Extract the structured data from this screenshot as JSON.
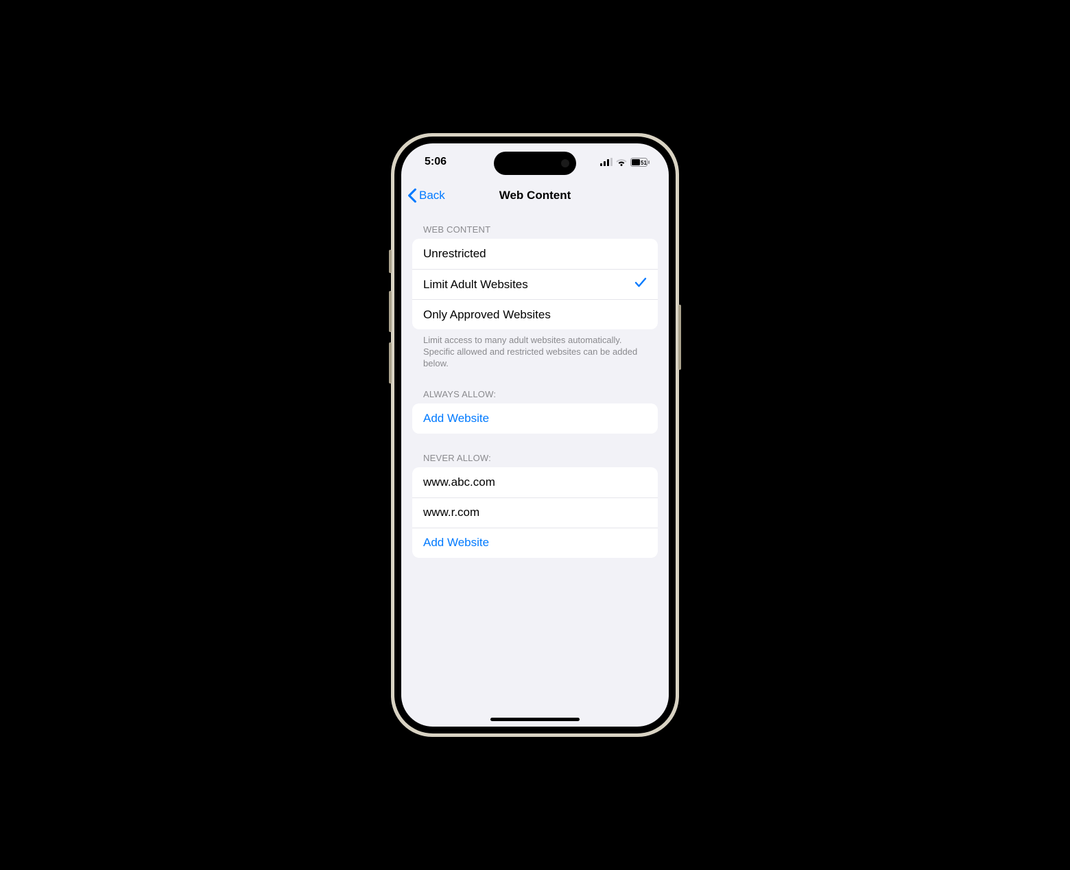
{
  "status_bar": {
    "time": "5:06",
    "battery_text": "51"
  },
  "nav": {
    "back_label": "Back",
    "title": "Web Content"
  },
  "web_content": {
    "header": "WEB CONTENT",
    "options": [
      {
        "label": "Unrestricted",
        "selected": false
      },
      {
        "label": "Limit Adult Websites",
        "selected": true
      },
      {
        "label": "Only Approved Websites",
        "selected": false
      }
    ],
    "footer": "Limit access to many adult websites automatically. Specific allowed and restricted websites can be added below."
  },
  "always_allow": {
    "header": "ALWAYS ALLOW:",
    "add_label": "Add Website"
  },
  "never_allow": {
    "header": "NEVER ALLOW:",
    "items": [
      {
        "label": "www.abc.com"
      },
      {
        "label": "www.r.com"
      }
    ],
    "add_label": "Add Website"
  }
}
